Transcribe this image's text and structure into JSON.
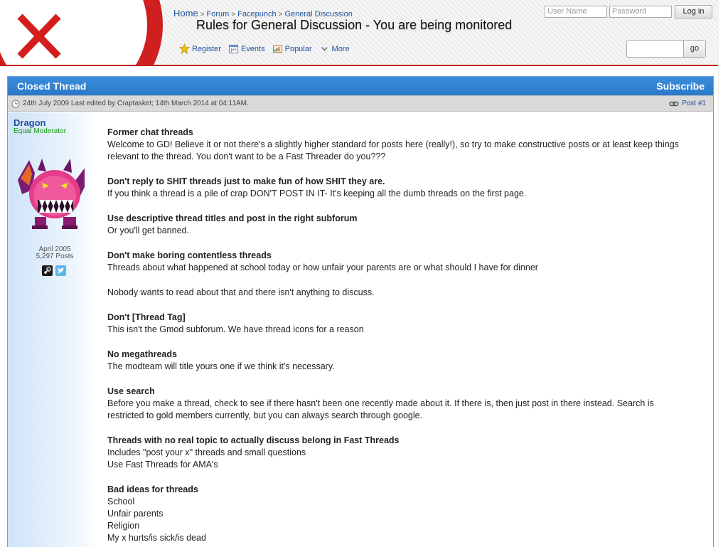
{
  "header": {
    "breadcrumbs": [
      "Home",
      "Forum",
      "Facepunch",
      "General Discussion"
    ],
    "page_title": "Rules for General Discussion - You are being monitored",
    "nav": [
      {
        "label": "Register",
        "icon": "star-icon"
      },
      {
        "label": "Events",
        "icon": "calendar-icon"
      },
      {
        "label": "Popular",
        "icon": "popular-icon"
      },
      {
        "label": "More",
        "icon": "chevron-down-icon"
      }
    ],
    "login": {
      "username_placeholder": "User Name",
      "password_placeholder": "Password",
      "button": "Log in"
    },
    "search": {
      "button": "go"
    }
  },
  "thread": {
    "status": "Closed Thread",
    "subscribe": "Subscribe",
    "meta": "24th July 2009 Last edited by Craptasket; 14th March 2014 at 04:11AM.",
    "post_number": "Post #1"
  },
  "user": {
    "name": "Dragon",
    "rank": "Equal Moderator",
    "joined": "April 2005",
    "posts": "5,297 Posts",
    "socials": [
      "steam-icon",
      "twitter-icon"
    ]
  },
  "rules": [
    {
      "heading": "Former chat threads",
      "lines": [
        "Welcome to GD! Believe it or not there's a slightly higher standard for posts here (really!), so try to make constructive posts or at least keep things relevant to the thread. You don't want to be a Fast Threader do you???"
      ]
    },
    {
      "heading": "Don't reply to SHIT threads just to make fun of how SHIT they are.",
      "lines": [
        "If you think a thread is a pile of crap DON'T POST IN IT- It's keeping all the dumb threads on the first page."
      ]
    },
    {
      "heading": "Use descriptive thread titles and post in the right subforum",
      "lines": [
        "Or you'll get banned."
      ]
    },
    {
      "heading": "Don't make boring contentless threads",
      "lines": [
        "Threads about what happened at school today or how unfair your parents are or what should I have for dinner"
      ]
    },
    {
      "heading": "",
      "lines": [
        "Nobody wants to read about that and there isn't anything to discuss."
      ]
    },
    {
      "heading": "Don't [Thread Tag]",
      "lines": [
        "This isn't the Gmod subforum. We have thread icons for a reason"
      ]
    },
    {
      "heading": "No megathreads",
      "lines": [
        "The modteam will title yours one if we think it's necessary."
      ]
    },
    {
      "heading": "Use search",
      "lines": [
        "Before you make a thread, check to see if there hasn't been one recently made about it. If there is, then just post in there instead. Search is restricted to gold members currently, but you can always search through google."
      ]
    },
    {
      "heading": "Threads with no real topic to actually discuss belong in Fast Threads",
      "lines": [
        "Includes \"post your x\" threads and small questions",
        "Use Fast Threads for AMA's"
      ]
    },
    {
      "heading": "Bad ideas for threads",
      "lines": [
        "School",
        "Unfair parents",
        "Religion",
        "My x hurts/is sick/is dead"
      ]
    }
  ],
  "colors": {
    "accent_bar": "#2f82d2",
    "header_rule": "#c21c1c",
    "link": "#1f4f9c",
    "rank": "#119911"
  }
}
